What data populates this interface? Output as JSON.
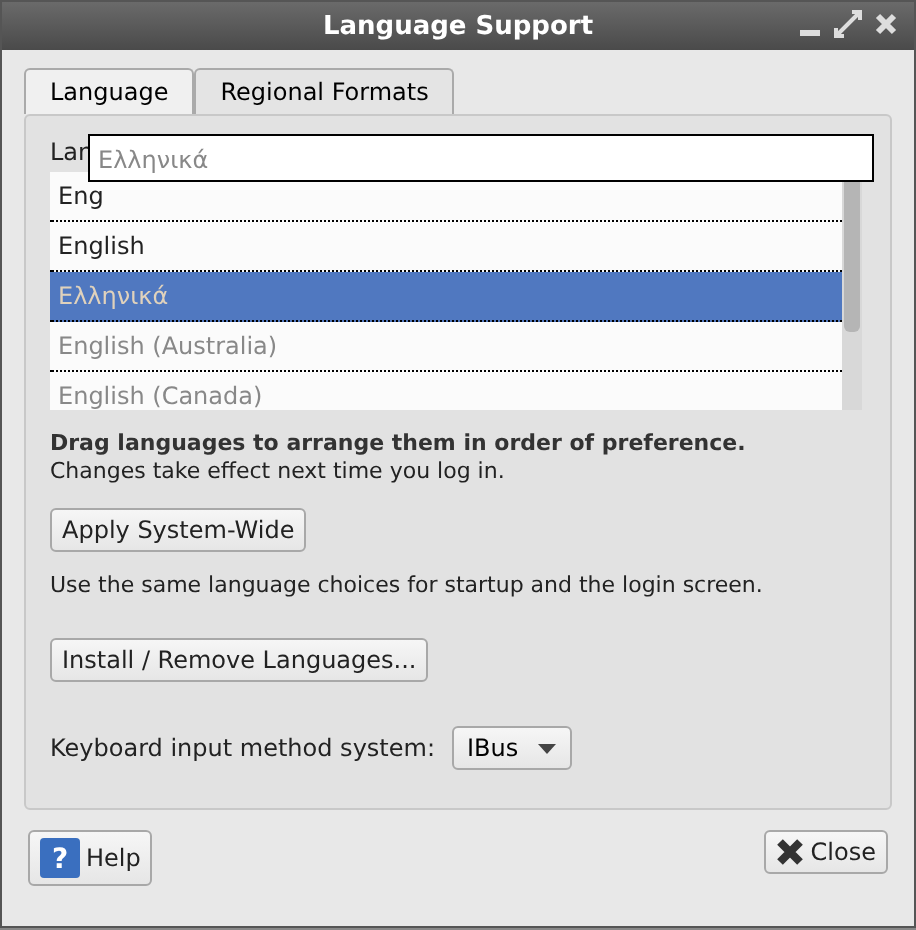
{
  "window": {
    "title": "Language Support"
  },
  "tabs": [
    {
      "label": "Language",
      "selected": true
    },
    {
      "label": "Regional Formats",
      "selected": false
    }
  ],
  "list_label": "Lan",
  "drag_label": "Ελληνικά",
  "languages": [
    {
      "name": "Eng",
      "selected": false,
      "dimmed": false
    },
    {
      "name": "English",
      "selected": false,
      "dimmed": false
    },
    {
      "name": "Ελληνικά",
      "selected": true,
      "dimmed": true
    },
    {
      "name": "English (Australia)",
      "selected": false,
      "dimmed": true
    },
    {
      "name": "English (Canada)",
      "selected": false,
      "dimmed": true
    }
  ],
  "hint_bold": "Drag languages to arrange them in order of preference.",
  "hint": "Changes take effect next time you log in.",
  "apply_button": "Apply System-Wide",
  "apply_note": "Use the same language choices for startup and the login screen.",
  "install_button": "Install / Remove Languages...",
  "input_method": {
    "label": "Keyboard input method system:",
    "value": "IBus"
  },
  "buttons": {
    "help_icon": "?",
    "help": "Help",
    "close": "Close"
  }
}
